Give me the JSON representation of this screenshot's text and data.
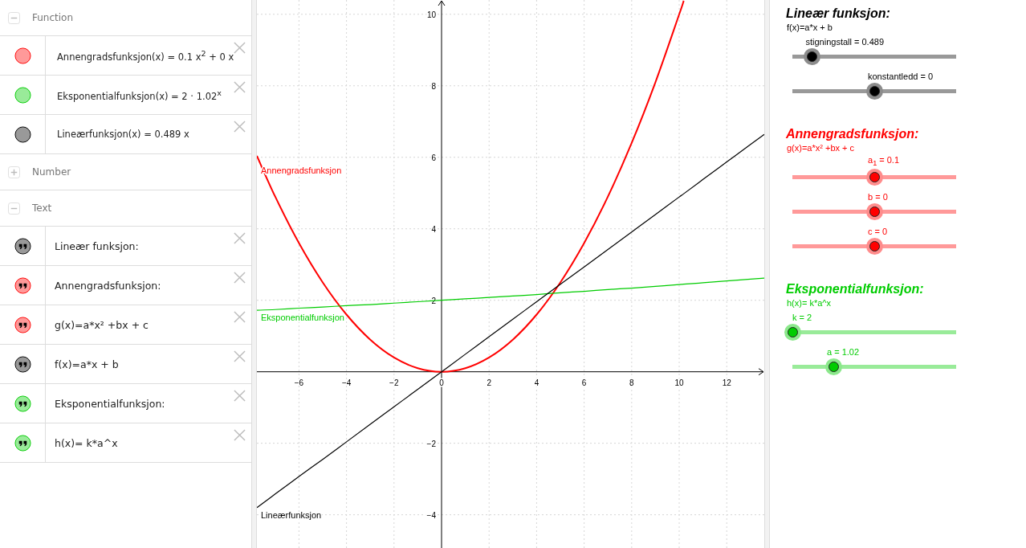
{
  "algebra": {
    "sections": [
      {
        "title": "Function",
        "expanded": true,
        "items": [
          {
            "kind": "function",
            "text": "Annengradsfunksjon(x) = 0.1 x$^{2}$ + 0 x",
            "color": "#ff9999"
          },
          {
            "kind": "function",
            "text": "Eksponentialfunksjon(x) = 2 · 1.02$^{x}$",
            "color": "#99eb99"
          },
          {
            "kind": "function",
            "text": "Lineærfunksjon(x) = 0.489 x",
            "color": "#999999"
          }
        ]
      },
      {
        "title": "Number",
        "expanded": false
      },
      {
        "title": "Text",
        "expanded": true,
        "items": [
          {
            "kind": "text",
            "text": "Lineær funksjon:",
            "color": "#999999"
          },
          {
            "kind": "text",
            "text": "Annengradsfunksjon:",
            "color": "#ff9999"
          },
          {
            "kind": "text",
            "text": "g(x)=a*x² +bx + c",
            "color": "#ff9999"
          },
          {
            "kind": "text",
            "text": "f(x)=a*x + b",
            "color": "#999999"
          },
          {
            "kind": "text",
            "text": "Eksponentialfunksjon:",
            "color": "#99eb99"
          },
          {
            "kind": "text",
            "text": "h(x)= k*a^x",
            "color": "#99eb99"
          }
        ]
      }
    ]
  },
  "graph": {
    "chart_data": {
      "type": "line",
      "x": [
        -7.77,
        -7,
        -6,
        -5,
        -4,
        -3,
        -2,
        -1,
        0,
        1,
        2,
        3,
        4,
        5,
        6,
        7,
        8,
        9,
        10,
        10.19,
        11,
        12,
        13,
        13.58
      ],
      "series": [
        {
          "name": "Annengradsfunksjon",
          "color": "#ff0000",
          "values": [
            6.04,
            4.9,
            3.6,
            2.5,
            1.6,
            0.9,
            0.4,
            0.1,
            0,
            0.1,
            0.4,
            0.9,
            1.6,
            2.5,
            3.6,
            4.9,
            6.4,
            8.1,
            10,
            10.38,
            null,
            null,
            null,
            null
          ]
        },
        {
          "name": "Eksponentialfunksjon",
          "color": "#00cc00",
          "values": [
            1.72,
            1.74,
            1.78,
            1.81,
            1.85,
            1.88,
            1.92,
            1.96,
            2,
            2.04,
            2.08,
            2.12,
            2.16,
            2.21,
            2.25,
            2.3,
            2.34,
            2.39,
            2.44,
            2.45,
            2.49,
            2.54,
            2.59,
            2.62
          ]
        },
        {
          "name": "Lineærfunksjon",
          "color": "#000000",
          "values": [
            -3.8,
            -3.42,
            -2.93,
            -2.45,
            -1.96,
            -1.47,
            -0.98,
            -0.49,
            0,
            0.49,
            0.98,
            1.47,
            1.96,
            2.45,
            2.93,
            3.42,
            3.91,
            4.4,
            4.89,
            4.98,
            5.38,
            5.87,
            6.36,
            6.64
          ]
        }
      ],
      "xlim": [
        -7.77,
        13.58
      ],
      "ylim": [
        -4.93,
        10.4
      ],
      "xticks": [
        {
          "value": -6,
          "label": "−6"
        },
        {
          "value": -4,
          "label": "−4"
        },
        {
          "value": -2,
          "label": "−2"
        },
        0,
        2,
        4,
        6,
        8,
        10,
        12
      ],
      "yticks": [
        {
          "value": -4,
          "label": "−4"
        },
        {
          "value": -2,
          "label": "−2"
        },
        2,
        4,
        6,
        8,
        10
      ],
      "grid": true
    }
  },
  "panels": [
    {
      "title": "Lineær funksjon:",
      "formula": "f(x)=a*x + b",
      "color": "#000000",
      "sliders": [
        {
          "label": "stigningstall = 0.489",
          "level": 0.12
        },
        {
          "label": "konstantledd = 0",
          "level": 0.5
        }
      ]
    },
    {
      "title": "Annengradsfunksjon:",
      "formula": "g(x)=a*x² +bx + c",
      "color": "#ff0000",
      "sliders": [
        {
          "label": "a$_{1}$ = 0.1",
          "level": 0.5
        },
        {
          "label": "b = 0",
          "level": 0.5
        },
        {
          "label": "c = 0",
          "level": 0.5
        }
      ]
    },
    {
      "title": "Eksponentialfunksjon:",
      "formula": "h(x)= k*a^x",
      "color": "#00cc00",
      "sliders": [
        {
          "label": "k = 2",
          "level": 0
        },
        {
          "label": "a = 1.02",
          "level": 0.25
        }
      ]
    }
  ]
}
